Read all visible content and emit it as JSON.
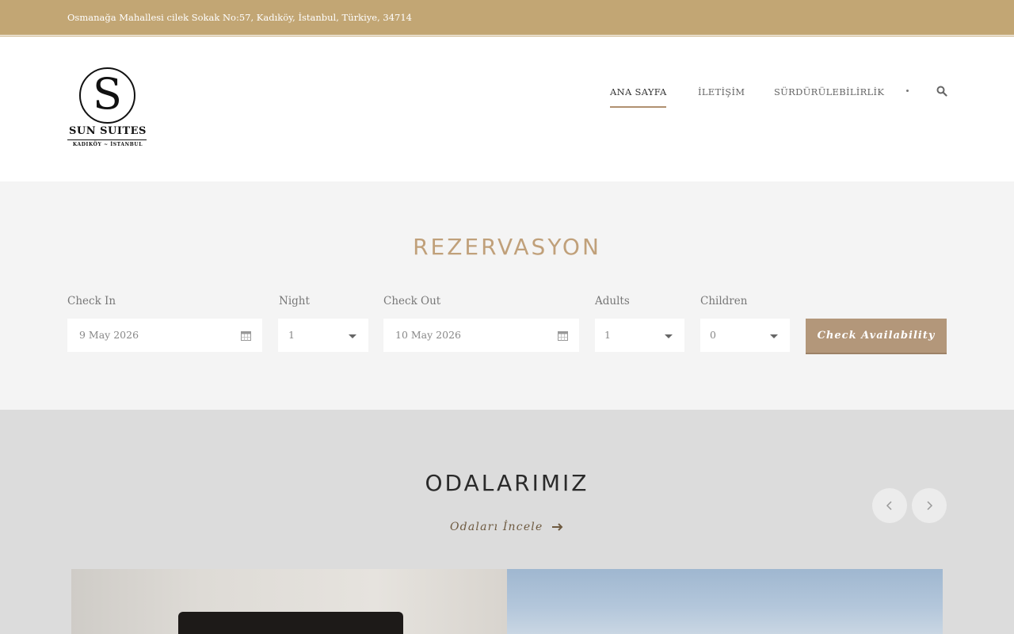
{
  "topbar": {
    "address": "Osmanağa Mahallesi cilek Sokak No:57, Kadıköy, İstanbul, Türkiye, 34714"
  },
  "logo": {
    "letter": "S",
    "name": "SUN SUITES",
    "subtitle": "KADIKÖY ~ İSTANBUL"
  },
  "nav": {
    "items": [
      {
        "label": "ANA SAYFA",
        "active": true
      },
      {
        "label": "İLETİŞİM",
        "active": false
      },
      {
        "label": "SÜRDÜRÜLEBİLİRLİK",
        "active": false
      }
    ],
    "search_icon": "search-icon"
  },
  "booking": {
    "title": "REZERVASYON",
    "check_in": {
      "label": "Check In",
      "value": "9 May 2026"
    },
    "night": {
      "label": "Night",
      "value": "1"
    },
    "check_out": {
      "label": "Check Out",
      "value": "10 May 2026"
    },
    "adults": {
      "label": "Adults",
      "value": "1"
    },
    "children": {
      "label": "Children",
      "value": "0"
    },
    "button_label": "Check Availability"
  },
  "rooms": {
    "title": "ODALARIMIZ",
    "link_label": "Odaları İncele",
    "prev_icon": "chevron-left-icon",
    "next_icon": "chevron-right-icon"
  },
  "colors": {
    "topbar": "#c2a674",
    "accent": "#b3977a",
    "booking_bg": "#f4f4f4",
    "rooms_bg": "#dcdcdc"
  }
}
